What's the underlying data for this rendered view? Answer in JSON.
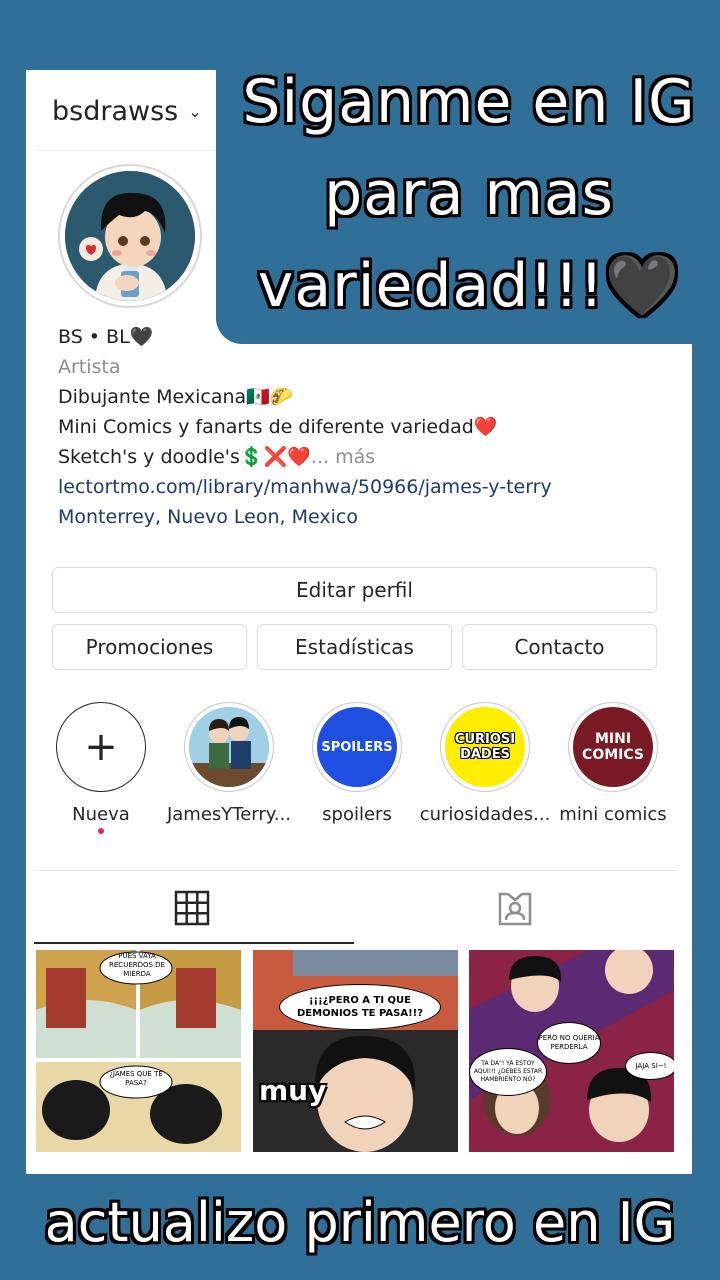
{
  "headline": "Siganme en IG para mas variedad!!!🖤",
  "bottom_caption": "actualizo primero en IG",
  "profile": {
    "username": "bsdrawss",
    "name": "BS • BL🖤",
    "category": "Artista",
    "bio_lines": [
      "Dibujante Mexicana🇲🇽🌮",
      "Mini Comics y fanarts de diferente variedad❤️",
      "Sketch's y doodle's💲❌❤️"
    ],
    "more": "... más",
    "link": "lectortmo.com/library/manhwa/50966/james-y-terry",
    "location": "Monterrey, Nuevo Leon, Mexico"
  },
  "buttons": {
    "edit": "Editar perfil",
    "promos": "Promociones",
    "stats": "Estadísticas",
    "contact": "Contacto"
  },
  "highlights": [
    {
      "label": "Nueva",
      "text": "+"
    },
    {
      "label": "JamesYTerry...",
      "text": ""
    },
    {
      "label": "spoilers",
      "text": "SPOILERS"
    },
    {
      "label": "curiosidades...",
      "text": "CURIOSI DADES"
    },
    {
      "label": "mini comics",
      "text": "MINI COMICS"
    }
  ],
  "tabs": {
    "grid": "grid-icon",
    "tagged": "tagged-icon"
  },
  "thumbnails": [
    {
      "bubbles": [
        "PUES VAYA RECUERDOS DE MIERDA",
        "¿JAMES QUE TE PASA?"
      ]
    },
    {
      "bubbles": [
        "¡¡¡¿PERO A TI QUE DEMONIOS TE PASA!!?",
        "muy"
      ]
    },
    {
      "bubbles": [
        "PERO NO QUERIA PERDERLA",
        "TA DA\"! YA ESTOY AQUI!!! ¿DEBES ESTAR HAMBRIENTO NO?",
        "JAJA SI~!"
      ]
    }
  ],
  "colors": {
    "background": "#2f6f98",
    "link": "#1d3b6b",
    "spoilers": "#1f4fe0",
    "curiosidades": "#ffee00",
    "mini_comics": "#7a1a24"
  }
}
